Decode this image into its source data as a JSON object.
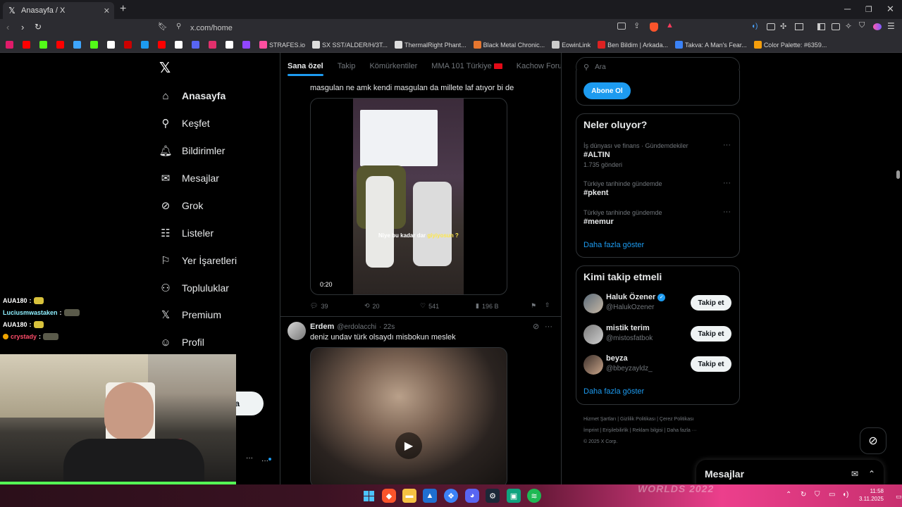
{
  "browser": {
    "tab_title": "Anasayfa / X",
    "tab_close": "✕",
    "new_tab": "+",
    "url": "x.com/home",
    "bookmarks": [
      {
        "label": "",
        "color": "#e01b6a"
      },
      {
        "label": "",
        "color": "#ff0000"
      },
      {
        "label": "",
        "color": "#53fc18"
      },
      {
        "label": "",
        "color": "#ff0000"
      },
      {
        "label": "",
        "color": "#3ea6ff"
      },
      {
        "label": "",
        "color": "#53fc18"
      },
      {
        "label": "",
        "color": "#ffffff"
      },
      {
        "label": "",
        "color": "#cc0000"
      },
      {
        "label": "",
        "color": "#1d9bf0"
      },
      {
        "label": "",
        "color": "#ff0000"
      },
      {
        "label": "",
        "color": "#ffffff"
      },
      {
        "label": "",
        "color": "#5865f2"
      },
      {
        "label": "",
        "color": "#e1306c"
      },
      {
        "label": "",
        "color": "#ffffff"
      },
      {
        "label": "",
        "color": "#9146ff"
      },
      {
        "label": "STRAFES.io",
        "color": "#ff4fa0"
      },
      {
        "label": "SX SST/ALDER/H/3T...",
        "color": "#dddddd"
      },
      {
        "label": "ThermalRight Phant...",
        "color": "#dddddd"
      },
      {
        "label": "Black Metal Chronic...",
        "color": "#e6762f"
      },
      {
        "label": "EowinLink",
        "color": "#cccccc"
      },
      {
        "label": "Ben Bildim | Arkada...",
        "color": "#d22"
      },
      {
        "label": "Takva: A Man's Fear...",
        "color": "#3b82f6"
      },
      {
        "label": "Color Palette: #6359...",
        "color": "#f59e0b"
      }
    ]
  },
  "nav": {
    "items": [
      {
        "label": "Anasayfa",
        "icon": "home-icon"
      },
      {
        "label": "Keşfet",
        "icon": "search-icon"
      },
      {
        "label": "Bildirimler",
        "icon": "bell-icon"
      },
      {
        "label": "Mesajlar",
        "icon": "mail-icon"
      },
      {
        "label": "Grok",
        "icon": "grok-icon"
      },
      {
        "label": "Listeler",
        "icon": "list-icon"
      },
      {
        "label": "Yer İşaretleri",
        "icon": "bookmark-icon"
      },
      {
        "label": "Topluluklar",
        "icon": "communities-icon"
      },
      {
        "label": "Premium",
        "icon": "x-logo-icon"
      },
      {
        "label": "Profil",
        "icon": "profile-icon"
      }
    ],
    "post_button_partial": "a",
    "more": "···"
  },
  "feed": {
    "tabs": [
      "Sana özel",
      "Takip",
      "Kömürkentiler",
      "MMA 101 Türkiye",
      "Kachow Forum"
    ],
    "tweet1": {
      "text": "masgulan ne amk kendi masgulan da millete laf atıyor bi de",
      "video_time": "0:20",
      "subtitle_a": "Niye bu kadar dar ",
      "subtitle_b": "giyiyosun ?",
      "replies": "39",
      "reposts": "20",
      "likes": "541",
      "views": "196 B"
    },
    "tweet2": {
      "name": "Erdem",
      "handle": "@erdolacchi",
      "time": "· 22s",
      "text": "deniz undav türk olsaydı misbokun meslek"
    }
  },
  "sidebar": {
    "search_placeholder": "Ara",
    "subscribe": "Abone Ol",
    "whats_happening": {
      "title": "Neler oluyor?",
      "trends": [
        {
          "meta": "İş dünyası ve finans · Gündemdekiler",
          "name": "#ALTIN",
          "count": "1.735 gönderi"
        },
        {
          "meta": "Türkiye tarihinde gündemde",
          "name": "#pkent",
          "count": ""
        },
        {
          "meta": "Türkiye tarihinde gündemde",
          "name": "#memur",
          "count": ""
        }
      ],
      "more": "Daha fazla göster"
    },
    "who_to_follow": {
      "title": "Kimi takip etmeli",
      "users": [
        {
          "name": "Haluk Özener",
          "handle": "@HalukOzener",
          "verified": true
        },
        {
          "name": "mistik terim",
          "handle": "@mistosfatbok",
          "verified": false
        },
        {
          "name": "beyza",
          "handle": "@bbeyzayldz_",
          "verified": false
        }
      ],
      "follow_label": "Takip et",
      "more": "Daha fazla göster"
    },
    "footer": {
      "line1": [
        "Hizmet Şartları",
        "Gizlilik Politikası",
        "Çerez Politikası"
      ],
      "line2": [
        "İmprint",
        "Erişilebilirlik",
        "Reklam bilgisi",
        "Daha fazla ···"
      ],
      "copyright": "© 2025 X Corp."
    }
  },
  "messages_dock": {
    "label": "Mesajlar"
  },
  "chat_overlay": [
    {
      "user": "AUA180",
      "color": "#ffffff",
      "sep": " :"
    },
    {
      "user": "Luciusmwastaken",
      "color": "#8ef0ff",
      "sep": " :"
    },
    {
      "user": "AUA180",
      "color": "#ffffff",
      "sep": " :"
    },
    {
      "user": "crystady",
      "color": "#ff4d6a",
      "sep": " :"
    }
  ],
  "taskbar": {
    "time": "11:58",
    "date": "3.11.2025",
    "wallpaper_text": "WORLDS  2022"
  }
}
